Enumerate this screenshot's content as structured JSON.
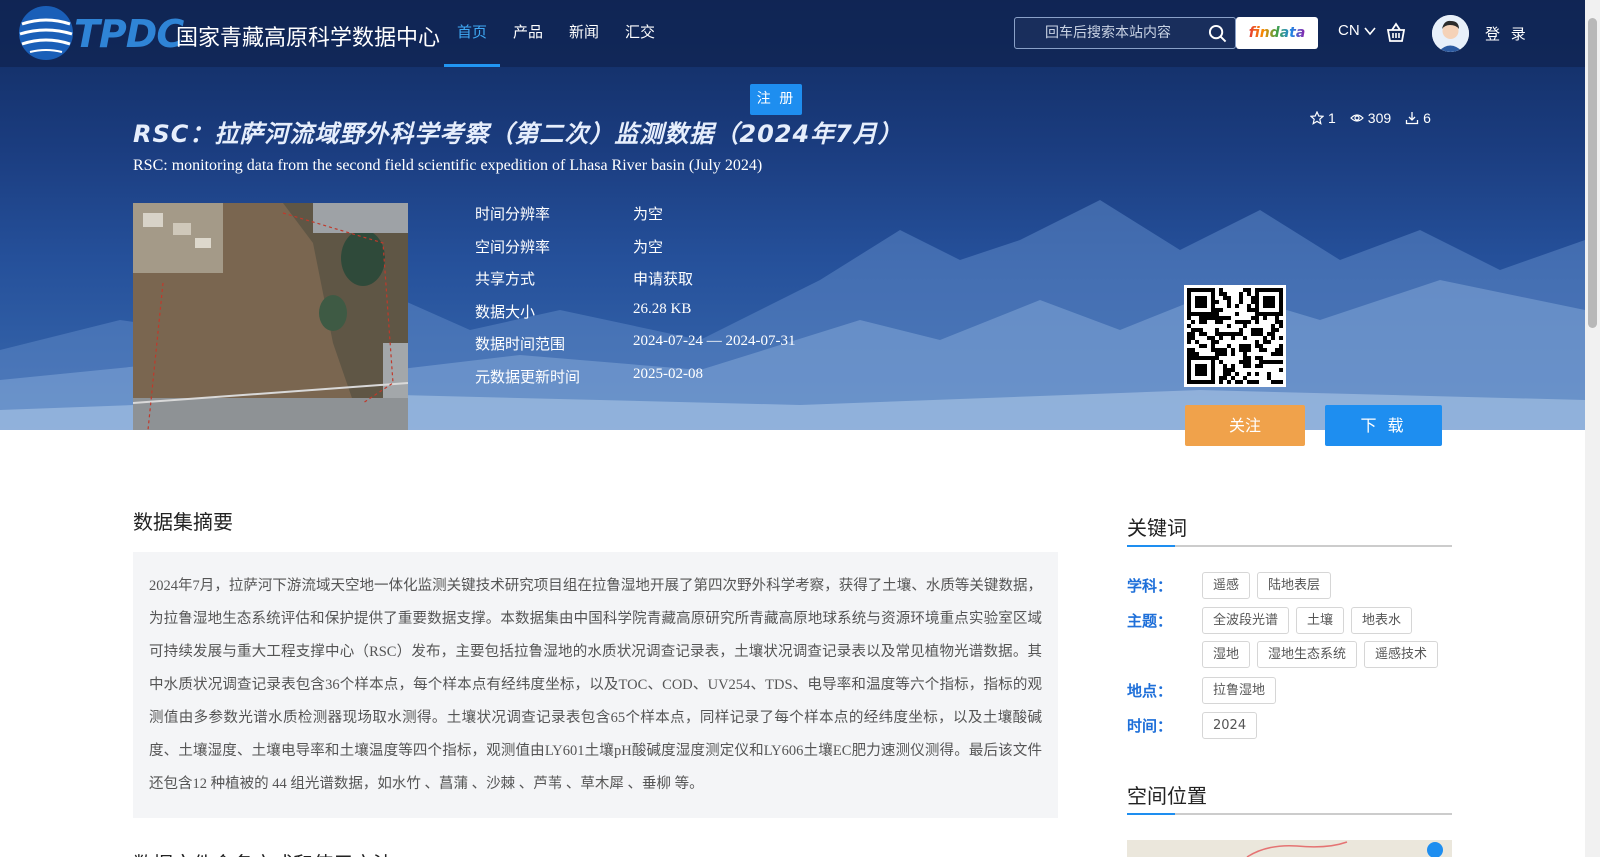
{
  "header": {
    "logo_abbr": "TPDC",
    "logo_name": "国家青藏高原科学数据中心",
    "nav": [
      {
        "label": "首页",
        "active": true
      },
      {
        "label": "产品",
        "active": false
      },
      {
        "label": "新闻",
        "active": false
      },
      {
        "label": "汇交",
        "active": false
      }
    ],
    "search_placeholder": "回车后搜索本站内容",
    "findata_label": "findata",
    "lang": "CN",
    "login": "登 录",
    "register": "注 册"
  },
  "dataset": {
    "title_cn": "RSC：拉萨河流域野外科学考察（第二次）监测数据（2024年7月）",
    "title_en": "RSC: monitoring data from the second field scientific expedition of Lhasa River basin (July 2024)",
    "stats": {
      "stars": "1",
      "views": "309",
      "downloads": "6"
    },
    "meta": [
      {
        "label": "时间分辨率",
        "value": "为空"
      },
      {
        "label": "空间分辨率",
        "value": "为空"
      },
      {
        "label": "共享方式",
        "value": "申请获取"
      },
      {
        "label": "数据大小",
        "value": "26.28 KB"
      },
      {
        "label": "数据时间范围",
        "value": "2024-07-24 — 2024-07-31"
      },
      {
        "label": "元数据更新时间",
        "value": "2025-02-08"
      }
    ],
    "follow_label": "关注",
    "download_label": "下 载"
  },
  "abstract": {
    "title": "数据集摘要",
    "text": "2024年7月，拉萨河下游流域天空地一体化监测关键技术研究项目组在拉鲁湿地开展了第四次野外科学考察，获得了土壤、水质等关键数据，为拉鲁湿地生态系统评估和保护提供了重要数据支撑。本数据集由中国科学院青藏高原研究所青藏高原地球系统与资源环境重点实验室区域可持续发展与重大工程支撑中心（RSC）发布，主要包括拉鲁湿地的水质状况调查记录表，土壤状况调查记录表以及常见植物光谱数据。其中水质状况调查记录表包含36个样本点，每个样本点有经纬度坐标，以及TOC、COD、UV254、TDS、电导率和温度等六个指标，指标的观测值由多参数光谱水质检测器现场取水测得。土壤状况调查记录表包含65个样本点，同样记录了每个样本点的经纬度坐标，以及土壤酸碱度、土壤湿度、土壤电导率和土壤温度等四个指标，观测值由LY601土壤pH酸碱度湿度测定仪和LY606土壤EC肥力速测仪测得。最后该文件还包含12 种植被的 44 组光谱数据，如水竹 、菖蒲 、沙棘 、芦苇 、草木犀 、垂柳 等。",
    "next_title": "数据文件命名方式和使用方法"
  },
  "sidebar": {
    "keywords_title": "关键词",
    "groups": [
      {
        "label": "学科：",
        "tags": [
          "遥感",
          "陆地表层"
        ]
      },
      {
        "label": "主题：",
        "tags": [
          "全波段光谱",
          "土壤",
          "地表水",
          "湿地",
          "湿地生态系统",
          "遥感技术"
        ]
      },
      {
        "label": "地点：",
        "tags": [
          "拉鲁湿地"
        ]
      },
      {
        "label": "时间：",
        "tags": [
          "2024"
        ]
      }
    ],
    "location_title": "空间位置"
  },
  "colors": {
    "accent": "#1e8ef0",
    "follow": "#f0a24b",
    "keyword_label": "#1e6fd9",
    "hero_dark": "#102a5e"
  }
}
